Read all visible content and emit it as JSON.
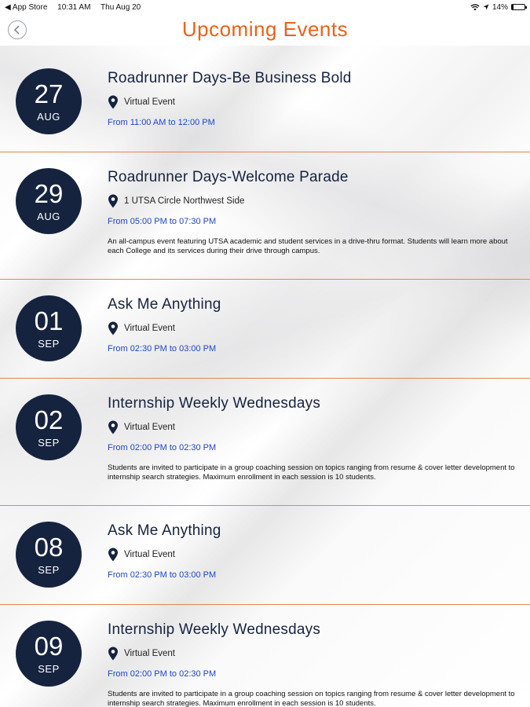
{
  "status_bar": {
    "carrier": "◀ App Store",
    "time": "10:31 AM",
    "date": "Thu Aug 20",
    "battery": "14%",
    "battery_level": 0.14
  },
  "header": {
    "title": "Upcoming Events"
  },
  "events": [
    {
      "day": "27",
      "month": "AUG",
      "title": "Roadrunner Days-Be Business Bold",
      "location": "Virtual Event",
      "time": "From 11:00 AM to 12:00 PM",
      "description": ""
    },
    {
      "day": "29",
      "month": "AUG",
      "title": "Roadrunner Days-Welcome Parade",
      "location": "1 UTSA Circle Northwest Side",
      "time": "From 05:00 PM to 07:30 PM",
      "description": "An all-campus event featuring UTSA academic and student services in a drive-thru format. Students will learn more about each College and its services during their drive through campus."
    },
    {
      "day": "01",
      "month": "SEP",
      "title": "Ask Me Anything",
      "location": "Virtual Event",
      "time": "From 02:30 PM to 03:00 PM",
      "description": ""
    },
    {
      "day": "02",
      "month": "SEP",
      "title": "Internship Weekly Wednesdays",
      "location": "Virtual Event",
      "time": "From 02:00 PM to 02:30 PM",
      "description": "Students are invited to participate in a group coaching session on topics ranging from resume & cover letter development to internship search strategies. Maximum enrollment in each session is 10 students."
    },
    {
      "day": "08",
      "month": "SEP",
      "title": "Ask Me Anything",
      "location": "Virtual Event",
      "time": "From 02:30 PM to 03:00 PM",
      "description": ""
    },
    {
      "day": "09",
      "month": "SEP",
      "title": "Internship Weekly Wednesdays",
      "location": "Virtual Event",
      "time": "From 02:00 PM to 02:30 PM",
      "description": "Students are invited to participate in a group coaching session on topics ranging from resume & cover letter development to internship search strategies. Maximum enrollment in each session is 10 students."
    }
  ],
  "colors": {
    "accent": "#e8621a",
    "badge": "#16233f",
    "time_link": "#1f47c7"
  }
}
